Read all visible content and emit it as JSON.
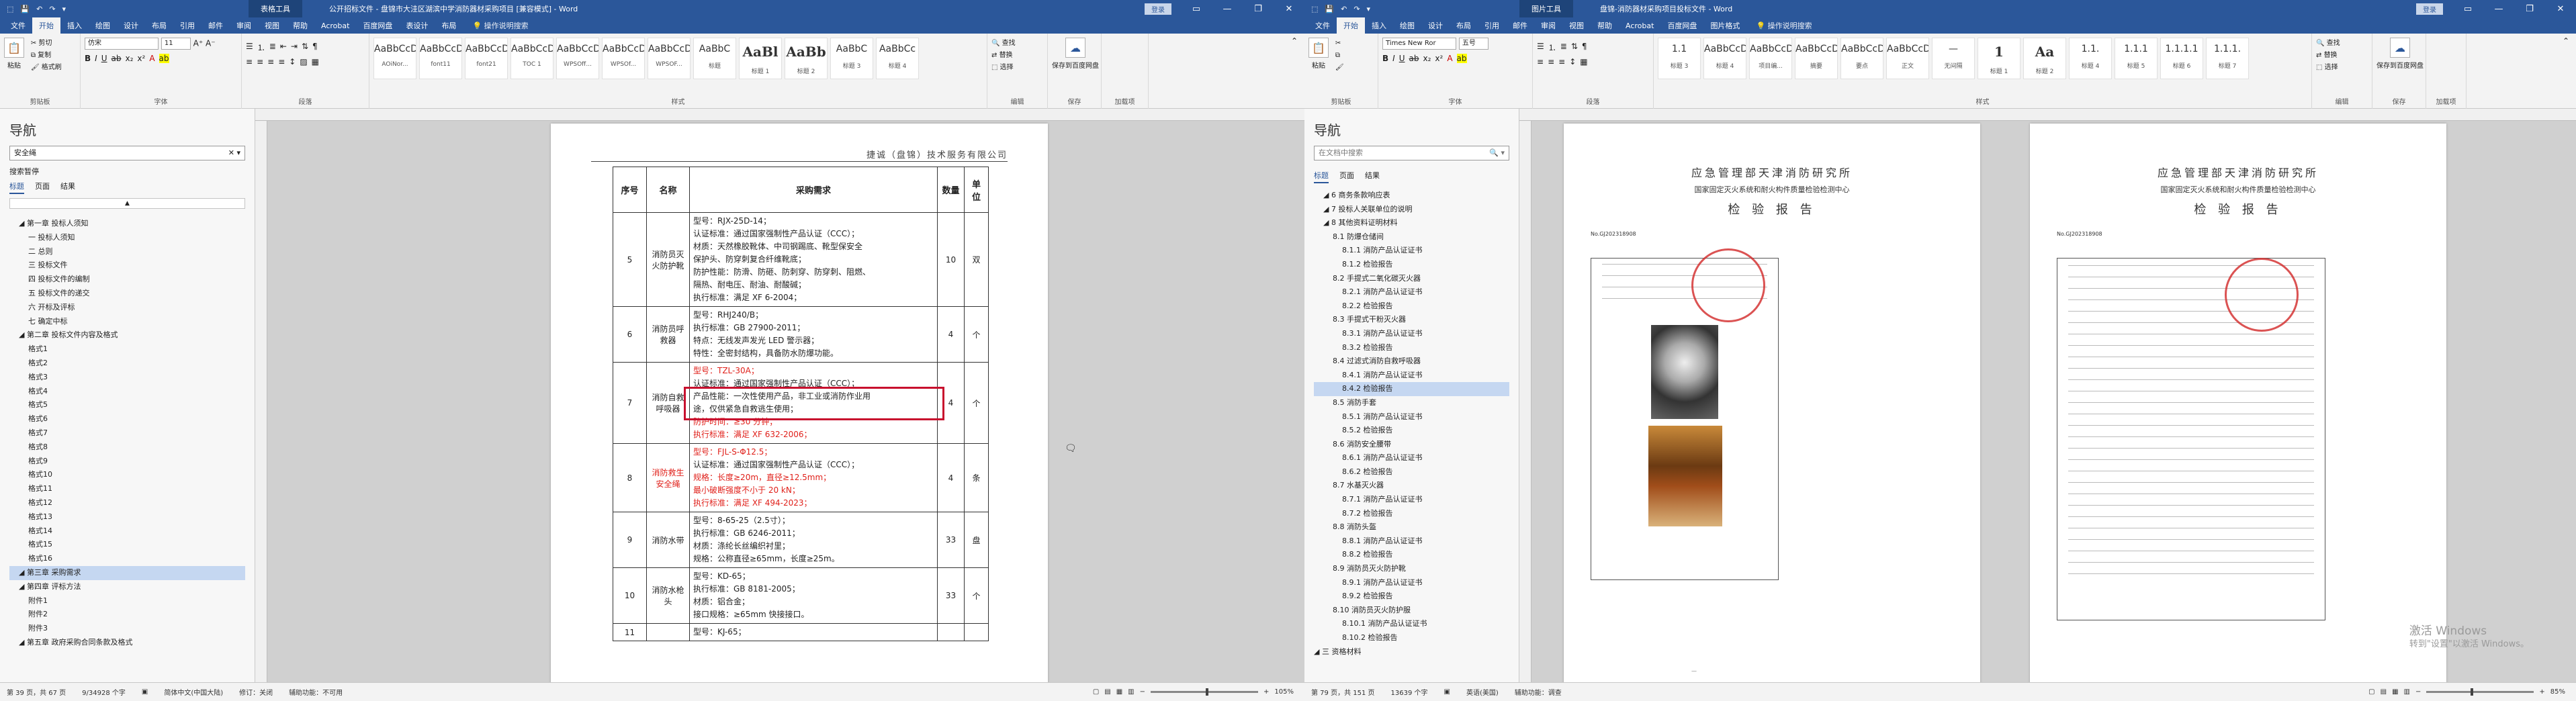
{
  "left": {
    "title_context": "表格工具",
    "title": "公开招标文件 - 盘锦市大洼区湖滨中学消防器材采购项目 [兼容模式] - Word",
    "user": "登录",
    "tabs": [
      "文件",
      "开始",
      "插入",
      "绘图",
      "设计",
      "布局",
      "引用",
      "邮件",
      "审阅",
      "视图",
      "帮助",
      "Acrobat",
      "百度网盘",
      "表设计",
      "布局"
    ],
    "tell": "操作说明搜索",
    "clipboard": {
      "paste": "粘贴",
      "cut": "剪切",
      "copy": "复制",
      "painter": "格式刷",
      "label": "剪贴板"
    },
    "font": {
      "name": "仿宋",
      "size": "11",
      "label": "字体"
    },
    "paragraph_label": "段落",
    "styles": [
      {
        "pv": "AaBbCcDd",
        "nm": "AOiNor..."
      },
      {
        "pv": "AaBbCcDd",
        "nm": "font11"
      },
      {
        "pv": "AaBbCcDd",
        "nm": "font21"
      },
      {
        "pv": "AaBbCcDd",
        "nm": "TOC 1"
      },
      {
        "pv": "AaBbCcDd",
        "nm": "WPSOff..."
      },
      {
        "pv": "AaBbCcDd",
        "nm": "WPSOf..."
      },
      {
        "pv": "AaBbCcDd",
        "nm": "WPSOF..."
      },
      {
        "pv": "AaBbC",
        "nm": "标题"
      },
      {
        "pv": "AaBl",
        "nm": "标题 1",
        "big": true
      },
      {
        "pv": "AaBb",
        "nm": "标题 2",
        "big": true
      },
      {
        "pv": "AaBbC",
        "nm": "标题 3"
      },
      {
        "pv": "AaBbCc",
        "nm": "标题 4"
      }
    ],
    "styles_label": "样式",
    "editing": {
      "find": "查找",
      "replace": "替换",
      "select": "选择",
      "label": "编辑"
    },
    "save_baidu": "保存到百度网盘",
    "save_label": "保存",
    "addin": "加载项",
    "nav": {
      "title": "导航",
      "search": "安全绳",
      "status": "搜索暂停",
      "tabs": [
        "标题",
        "页面",
        "结果"
      ],
      "items": [
        "第一章 投标人须知",
        "一 投标人须知",
        "二 总则",
        "三 投标文件",
        "四 投标文件的编制",
        "五 投标文件的递交",
        "六 开标及评标",
        "七 确定中标",
        "第二章 投标文件内容及格式",
        "格式1",
        "格式2",
        "格式3",
        "格式4",
        "格式5",
        "格式6",
        "格式7",
        "格式8",
        "格式9",
        "格式10",
        "格式11",
        "格式12",
        "格式13",
        "格式14",
        "格式15",
        "格式16",
        "第三章 采购需求",
        "第四章 评标方法",
        "附件1",
        "附件2",
        "附件3",
        "第五章 政府采购合同条款及格式"
      ],
      "indent": [
        1,
        2,
        2,
        2,
        2,
        2,
        2,
        2,
        1,
        2,
        2,
        2,
        2,
        2,
        2,
        2,
        2,
        2,
        2,
        2,
        2,
        2,
        2,
        2,
        2,
        1,
        1,
        2,
        2,
        2,
        1
      ],
      "highlight_index": 25
    },
    "doc": {
      "header": "捷诚（盘锦）技术服务有限公司",
      "cols": [
        "序号",
        "名称",
        "采购需求",
        "数量",
        "单位"
      ],
      "rows": [
        {
          "no": "5",
          "name": "消防员灭火防护靴",
          "qty": "10",
          "unit": "双",
          "lines": [
            {
              "t": "型号：RJX-25D-14；"
            },
            {
              "t": "认证标准：通过国家强制性产品认证（CCC）；"
            },
            {
              "t": "材质：天然橡胶靴体、中司钢踢底、靴型保安全"
            },
            {
              "t": "保护头、防穿刺复合纤维靴底；"
            },
            {
              "t": "防护性能：防滑、防砸、防刺穿、防穿刺、阻燃、"
            },
            {
              "t": "隔热、耐电压、耐油、耐酸碱；"
            },
            {
              "t": "执行标准：满足 XF 6-2004；"
            }
          ]
        },
        {
          "no": "6",
          "name": "消防员呼救器",
          "qty": "4",
          "unit": "个",
          "lines": [
            {
              "t": "型号：RHJ240/B；"
            },
            {
              "t": "执行标准：GB 27900-2011；"
            },
            {
              "t": "特点：无线发声发光 LED 警示器；"
            },
            {
              "t": "特性：全密封结构，具备防水防爆功能。"
            }
          ]
        },
        {
          "no": "7",
          "name": "消防自救呼吸器",
          "qty": "4",
          "unit": "个",
          "lines": [
            {
              "t": "型号：TZL-30A；",
              "r": true
            },
            {
              "t": "认证标准：通过国家强制性产品认证（CCC）；"
            },
            {
              "t": "产品性能：一次性使用产品，非工业或消防作业用"
            },
            {
              "t": "途，仅供紧急自救逃生使用；"
            },
            {
              "t": "防护时间：≥30 分钟；",
              "r": true
            },
            {
              "t": "执行标准：满足 XF 632-2006；",
              "r": true
            }
          ]
        },
        {
          "no": "8",
          "name": "消防救生安全绳",
          "qty": "4",
          "unit": "条",
          "red": true,
          "lines": [
            {
              "t": "型号：FJL-S-Φ12.5；",
              "r": true
            },
            {
              "t": "认证标准：通过国家强制性产品认证（CCC）；"
            },
            {
              "t": "规格：长度≥20m，直径≥12.5mm；",
              "r": true
            },
            {
              "t": "最小破断强度不小于 20 kN；",
              "r": true
            },
            {
              "t": "执行标准：满足 XF 494-2023；",
              "r": true
            }
          ]
        },
        {
          "no": "9",
          "name": "消防水带",
          "qty": "33",
          "unit": "盘",
          "lines": [
            {
              "t": "型号：8-65-25（2.5寸）；"
            },
            {
              "t": "执行标准：GB 6246-2011；"
            },
            {
              "t": "材质：涤纶长丝编织衬里；"
            },
            {
              "t": "规格：公称直径≥65mm，长度≥25m。"
            }
          ]
        },
        {
          "no": "10",
          "name": "消防水枪头",
          "qty": "33",
          "unit": "个",
          "lines": [
            {
              "t": "型号：KD-65；"
            },
            {
              "t": "执行标准：GB 8181-2005；"
            },
            {
              "t": "材质：铝合金；"
            },
            {
              "t": "接口规格：≥65mm 快接接口。"
            }
          ]
        },
        {
          "no": "11",
          "name": "",
          "qty": "",
          "unit": "",
          "lines": [
            {
              "t": "型号：KJ-65；"
            }
          ]
        }
      ]
    },
    "status": {
      "page": "第 39 页，共 67 页",
      "words": "9/34928 个字",
      "lang": "简体中文(中国大陆)",
      "mode": "辅助功能：不可用",
      "track": "修订：关闭",
      "zoom": "105%"
    }
  },
  "right": {
    "title_context": "图片工具",
    "title": "盘锦-消防器材采购项目投标文件 - Word",
    "user": "登录",
    "tabs": [
      "文件",
      "开始",
      "插入",
      "绘图",
      "设计",
      "布局",
      "引用",
      "邮件",
      "审阅",
      "视图",
      "帮助",
      "Acrobat",
      "百度网盘",
      "图片格式"
    ],
    "tell": "操作说明搜索",
    "font": {
      "name": "Times New Ror",
      "size": "五号"
    },
    "styles": [
      {
        "pv": "1.1",
        "nm": "标题 3"
      },
      {
        "pv": "AaBbCcDc",
        "nm": "标题 4"
      },
      {
        "pv": "AaBbCcD",
        "nm": "项目编..."
      },
      {
        "pv": "AaBbCcD",
        "nm": "摘要"
      },
      {
        "pv": "AaBbCcD",
        "nm": "要点"
      },
      {
        "pv": "AaBbCcDc",
        "nm": "正文"
      },
      {
        "pv": "—",
        "nm": "无间隔"
      },
      {
        "pv": "1",
        "nm": "标题 1",
        "big": true
      },
      {
        "pv": "Aa",
        "nm": "标题 2",
        "big": true
      },
      {
        "pv": "1.1.",
        "nm": "标题 4"
      },
      {
        "pv": "1.1.1",
        "nm": "标题 5"
      },
      {
        "pv": "1.1.1.1",
        "nm": "标题 6"
      },
      {
        "pv": "1.1.1.",
        "nm": "标题 7"
      }
    ],
    "nav": {
      "title": "导航",
      "search": "在文档中搜索",
      "tabs": [
        "标题",
        "页面",
        "结果"
      ],
      "items": [
        "6 商务条款响应表",
        "7 投标人关联单位的说明",
        "8 其他资料证明材料",
        "8.1 防爆仓储间",
        "8.1.1 消防产品认证证书",
        "8.1.2 检验报告",
        "8.2 手提式二氧化碳灭火器",
        "8.2.1 消防产品认证证书",
        "8.2.2 检验报告",
        "8.3 手提式干粉灭火器",
        "8.3.1 消防产品认证证书",
        "8.3.2 检验报告",
        "8.4 过滤式消防自救呼吸器",
        "8.4.1 消防产品认证证书",
        "8.4.2 检验报告",
        "8.5 消防手套",
        "8.5.1 消防产品认证证书",
        "8.5.2 检验报告",
        "8.6 消防安全腰带",
        "8.6.1 消防产品认证证书",
        "8.6.2 检验报告",
        "8.7 水基灭火器",
        "8.7.1 消防产品认证证书",
        "8.7.2 检验报告",
        "8.8 消防头盔",
        "8.8.1 消防产品认证证书",
        "8.8.2 检验报告",
        "8.9 消防员灭火防护靴",
        "8.9.1 消防产品认证证书",
        "8.9.2 检验报告",
        "8.10 消防员灭火防护服",
        "8.10.1 消防产品认证证书",
        "8.10.2 检验报告",
        "三 资格材料"
      ],
      "indent": [
        1,
        1,
        1,
        2,
        3,
        3,
        2,
        3,
        3,
        2,
        3,
        3,
        2,
        3,
        3,
        2,
        3,
        3,
        2,
        3,
        3,
        2,
        3,
        3,
        2,
        3,
        3,
        2,
        3,
        3,
        2,
        3,
        3,
        0
      ],
      "highlight_index": 14
    },
    "report_left": {
      "h1": "应急管理部天津消防研究所",
      "h2": "国家固定灭火系统和耐火构件质量检验检测中心",
      "h3": "检 验 报 告",
      "no": "No.GJ202318908"
    },
    "report_right": {
      "h1": "应急管理部天津消防研究所",
      "h2": "国家固定灭火系统和耐火构件质量检验检测中心",
      "h3": "检 验 报 告",
      "no": "No.GJ202318908"
    },
    "status": {
      "page": "第 79 页，共 151 页",
      "words": "13639 个字",
      "lang": "英语(美国)",
      "mode": "辅助功能：调查",
      "zoom": "85%"
    },
    "activate": {
      "title": "激活 Windows",
      "sub": "转到\"设置\"以激活 Windows。"
    }
  }
}
